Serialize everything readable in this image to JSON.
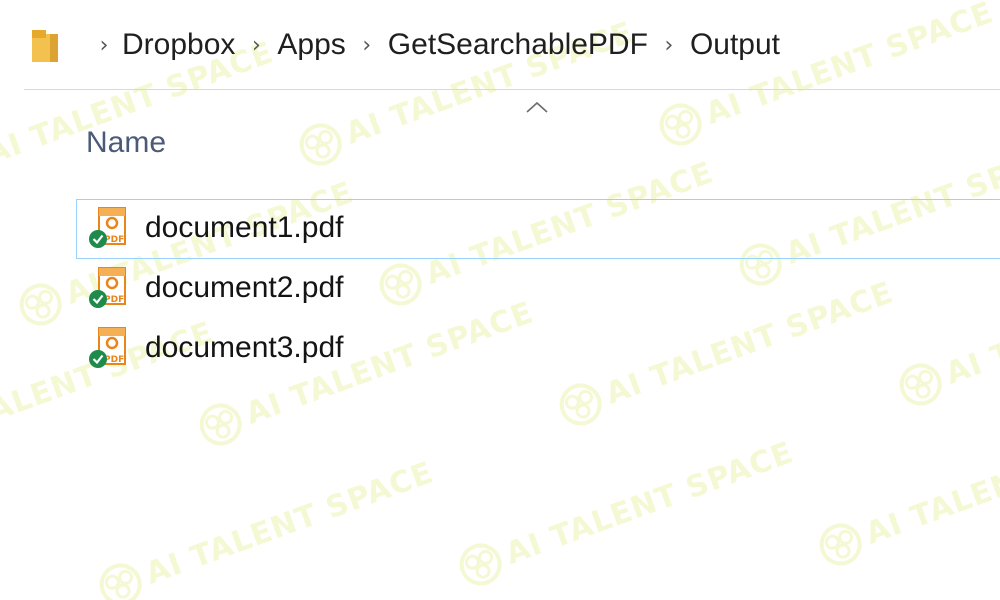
{
  "breadcrumb": {
    "items": [
      {
        "label": "Dropbox"
      },
      {
        "label": "Apps"
      },
      {
        "label": "GetSearchablePDF"
      },
      {
        "label": "Output"
      }
    ],
    "separator": "›"
  },
  "columns": {
    "name": "Name",
    "sort": "ascending"
  },
  "files": [
    {
      "name": "document1.pdf",
      "type": "pdf",
      "sync_status": "synced",
      "selected": true
    },
    {
      "name": "document2.pdf",
      "type": "pdf",
      "sync_status": "synced",
      "selected": false
    },
    {
      "name": "document3.pdf",
      "type": "pdf",
      "sync_status": "synced",
      "selected": false
    }
  ],
  "watermark": {
    "text": "AI TALENT SPACE"
  },
  "colors": {
    "folder": "#f2c14e",
    "pdf_badge": "#e8861c",
    "sync_ok": "#1e8a4c",
    "selection_border": "#99d1ff",
    "watermark": "#f3f8cf"
  }
}
